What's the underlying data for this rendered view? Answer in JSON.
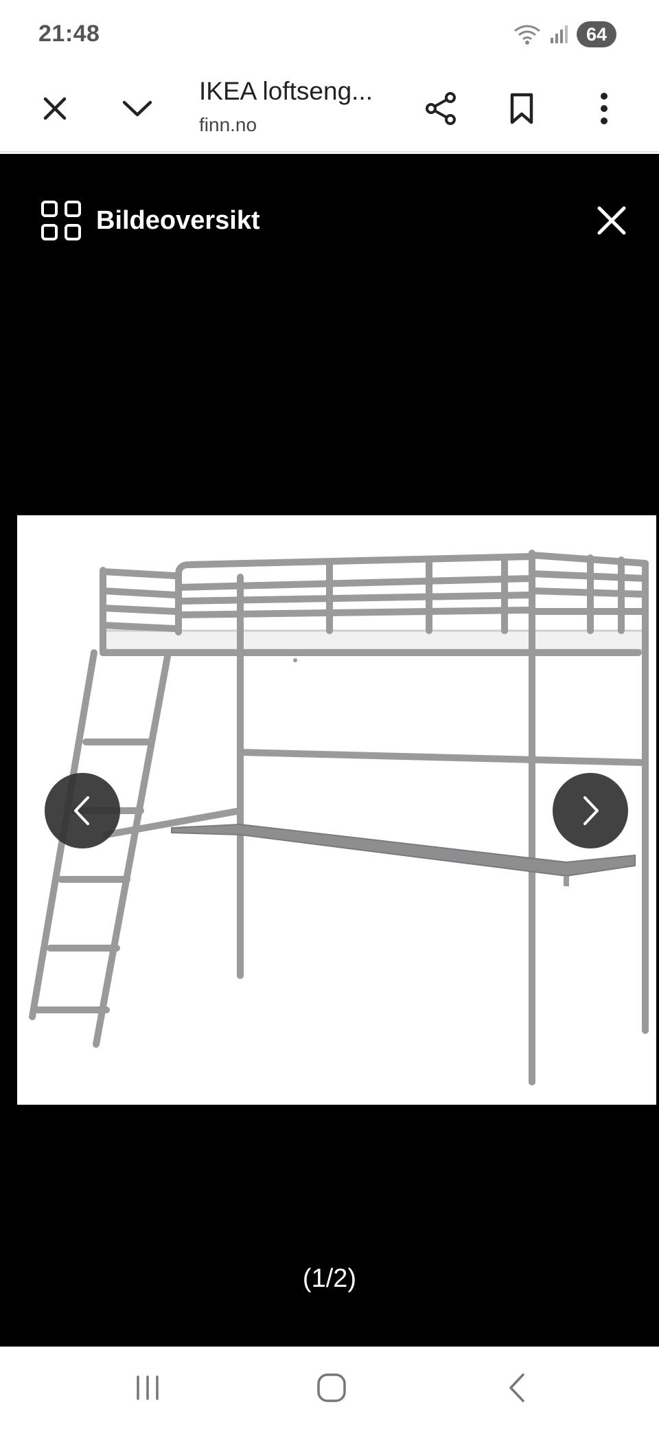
{
  "status_bar": {
    "time": "21:48",
    "battery": "64",
    "icons": [
      "wifi-icon",
      "signal-icon",
      "battery-icon"
    ]
  },
  "browser_bar": {
    "title": "IKEA loftseng...",
    "domain": "finn.no",
    "icons": [
      "close-icon",
      "chevron-down-icon",
      "share-icon",
      "bookmark-icon",
      "more-vert-icon"
    ]
  },
  "viewer": {
    "title": "Bildeoversikt",
    "counter": "(1/2)",
    "icons": [
      "grid-icon",
      "close-icon",
      "chevron-left-icon",
      "chevron-right-icon"
    ]
  },
  "nav_bar": {
    "icons": [
      "recent-apps-icon",
      "home-icon",
      "back-icon"
    ]
  },
  "colors": {
    "viewer_background": "#000000",
    "bed_frame": "#9a9a9c",
    "arrow_button": "#323232"
  }
}
